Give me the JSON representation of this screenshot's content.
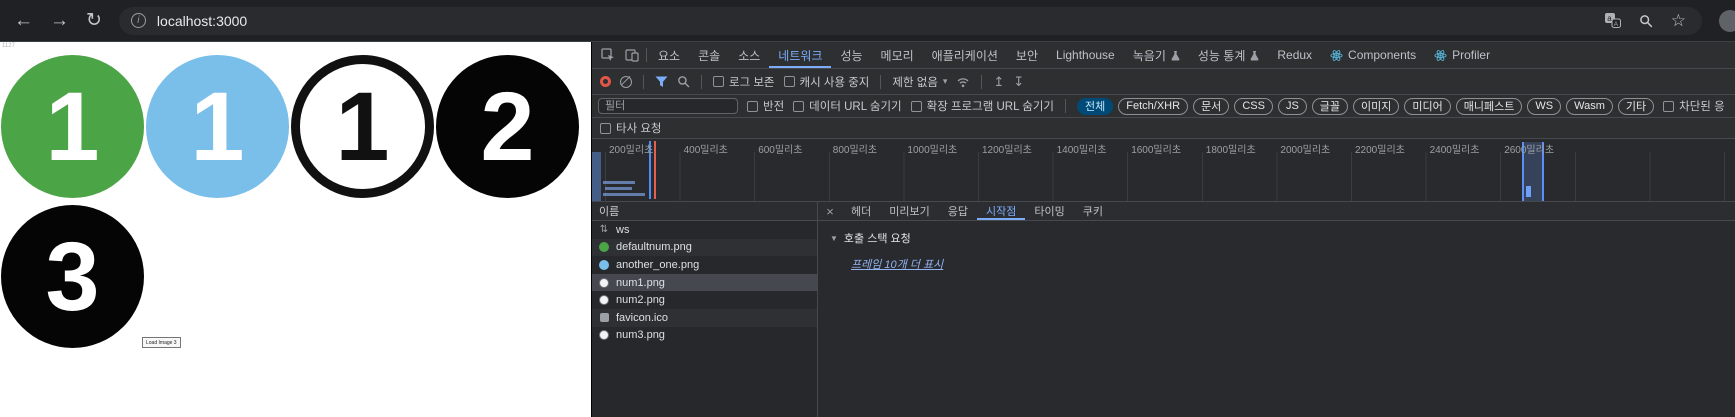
{
  "icons": {
    "back": "←",
    "forward": "→",
    "reload": "↻",
    "info": "i",
    "star": "☆",
    "caret_down": "▾",
    "disclosure": "▼",
    "close": "×",
    "import": "↥",
    "export": "↧",
    "websocket": "⇅"
  },
  "browser": {
    "url": "localhost:3000"
  },
  "page": {
    "corner_text": "1127",
    "circles": [
      {
        "label": "1",
        "bg": "#4ba446",
        "fg": "#ffffff",
        "border": ""
      },
      {
        "label": "1",
        "bg": "#79bfea",
        "fg": "#ffffff",
        "border": ""
      },
      {
        "label": "1",
        "bg": "#ffffff",
        "fg": "#111111",
        "border": "#111111"
      },
      {
        "label": "2",
        "bg": "#050505",
        "fg": "#ffffff",
        "border": ""
      },
      {
        "label": "3",
        "bg": "#050505",
        "fg": "#ffffff",
        "border": ""
      }
    ],
    "load_button_label": "Load Image 3"
  },
  "devtools": {
    "main_tabs": [
      {
        "id": "elements",
        "label": "요소"
      },
      {
        "id": "console",
        "label": "콘솔"
      },
      {
        "id": "sources",
        "label": "소스"
      },
      {
        "id": "network",
        "label": "네트워크",
        "selected": true
      },
      {
        "id": "performance",
        "label": "성능"
      },
      {
        "id": "memory",
        "label": "메모리"
      },
      {
        "id": "application",
        "label": "애플리케이션"
      },
      {
        "id": "security",
        "label": "보안"
      },
      {
        "id": "lighthouse",
        "label": "Lighthouse"
      },
      {
        "id": "recorder",
        "label": "녹음기",
        "badge": "flask"
      },
      {
        "id": "performance-insights",
        "label": "성능 통계",
        "badge": "flask"
      },
      {
        "id": "redux",
        "label": "Redux"
      },
      {
        "id": "components",
        "label": "Components",
        "badge": "react"
      },
      {
        "id": "profiler",
        "label": "Profiler",
        "badge": "react"
      }
    ],
    "toolbar": {
      "preserve_log_label": "로그 보존",
      "disable_cache_label": "캐시 사용 중지",
      "throttling_value": "제한 없음"
    },
    "filter_bar": {
      "filter_placeholder": "필터",
      "invert_label": "반전",
      "hide_data_urls_label": "데이터 URL 숨기기",
      "hide_extension_urls_label": "확장 프로그램 URL 숨기기",
      "chips": [
        {
          "label": "전체",
          "selected": true
        },
        {
          "label": "Fetch/XHR"
        },
        {
          "label": "문서"
        },
        {
          "label": "CSS"
        },
        {
          "label": "JS"
        },
        {
          "label": "글꼴"
        },
        {
          "label": "이미지"
        },
        {
          "label": "미디어"
        },
        {
          "label": "매니페스트"
        },
        {
          "label": "WS"
        },
        {
          "label": "Wasm"
        },
        {
          "label": "기타"
        }
      ],
      "blocked_cookies_label": "차단된 응"
    },
    "third_party_label": "타사 요청",
    "timeline": {
      "tick_labels": [
        "200밀리초",
        "400밀리초",
        "600밀리초",
        "800밀리초",
        "1000밀리초",
        "1200밀리초",
        "1400밀리초",
        "1600밀리초",
        "1800밀리초",
        "2000밀리초",
        "2200밀리초",
        "2400밀리초",
        "2600밀리초"
      ]
    },
    "requests": {
      "name_header": "이름",
      "rows": [
        {
          "name": "ws",
          "icon": "websocket"
        },
        {
          "name": "defaultnum.png",
          "icon": "image-green"
        },
        {
          "name": "another_one.png",
          "icon": "image-blue"
        },
        {
          "name": "num1.png",
          "icon": "image-white",
          "selected": true
        },
        {
          "name": "num2.png",
          "icon": "image-white"
        },
        {
          "name": "favicon.ico",
          "icon": "image-gray"
        },
        {
          "name": "num3.png",
          "icon": "image-white"
        }
      ]
    },
    "details": {
      "tabs": [
        {
          "label": "헤더"
        },
        {
          "label": "미리보기"
        },
        {
          "label": "응답"
        },
        {
          "label": "시작점",
          "selected": true
        },
        {
          "label": "타이밍"
        },
        {
          "label": "쿠키"
        }
      ],
      "initiator_section_label": "호출 스택 요청",
      "show_more_link": "프레임 10개 더 표시"
    },
    "colors": {
      "accent": "#7cacf8",
      "record_red": "#e25549",
      "chip_selected_bg": "#004a77",
      "chip_selected_fg": "#c2e7ff"
    }
  }
}
